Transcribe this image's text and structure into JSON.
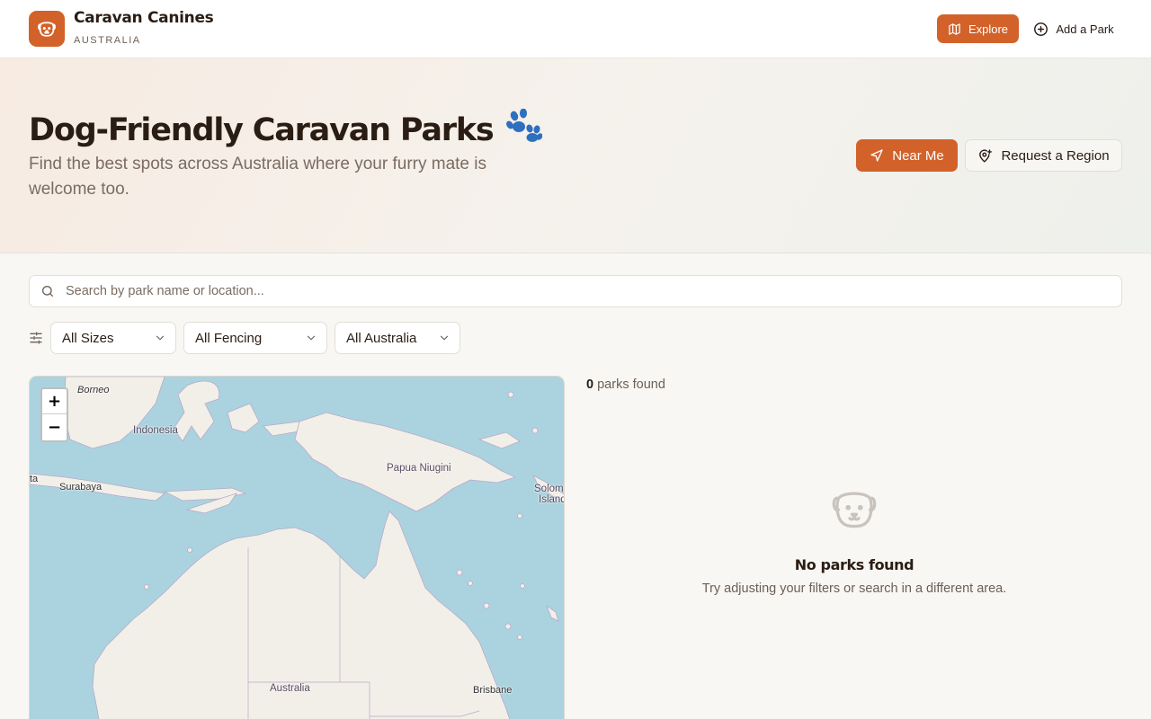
{
  "brand": {
    "name": "Caravan Canines",
    "subtitle": "AUSTRALIA"
  },
  "nav": {
    "explore_label": "Explore",
    "add_park_label": "Add a Park"
  },
  "hero": {
    "title": "Dog-Friendly Caravan Parks",
    "title_emoji": "🐾",
    "subtitle": "Find the best spots across Australia where your furry mate is welcome too.",
    "near_me_label": "Near Me",
    "request_region_label": "Request a Region"
  },
  "search": {
    "placeholder": "Search by park name or location..."
  },
  "filters": {
    "size": "All Sizes",
    "fencing": "All Fencing",
    "region": "All Australia"
  },
  "map": {
    "zoom_in": "+",
    "zoom_out": "−",
    "labels": {
      "borneo": "Borneo",
      "indonesia": "Indonesia",
      "papua": "Papua Niugini",
      "surabaya": "Surabaya",
      "ta": "ta",
      "solomon_1": "Solom",
      "solomon_2": "Island",
      "australia": "Australia",
      "brisbane": "Brisbane"
    }
  },
  "results": {
    "count": "0",
    "count_suffix": "parks found",
    "empty_title": "No parks found",
    "empty_subtitle": "Try adjusting your filters or search in a different area."
  },
  "colors": {
    "accent": "#d2622a",
    "ocean": "#aad3df",
    "land": "#f2efe9"
  },
  "icons": {
    "logo": "dog-face-icon",
    "explore": "map-icon",
    "add": "plus-circle-icon",
    "near_me": "navigation-icon",
    "request": "map-pin-plus-icon",
    "search": "search-icon",
    "filters": "sliders-icon",
    "chevron": "chevron-down-icon",
    "empty": "dog-face-icon"
  }
}
